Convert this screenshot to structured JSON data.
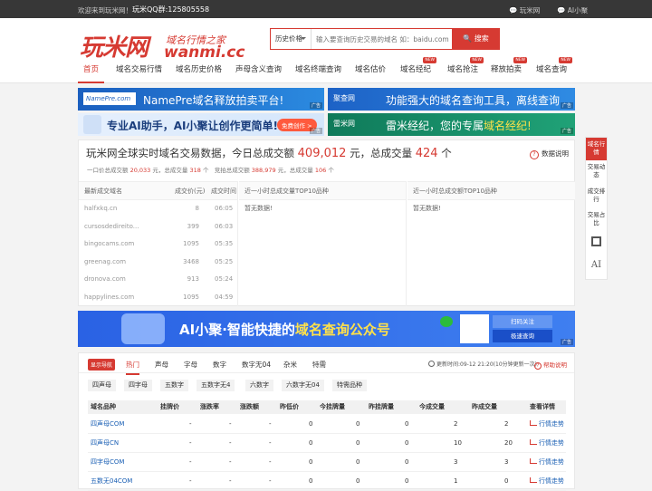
{
  "topbar": {
    "welcome": "欢迎来到玩米网！",
    "qq": "玩米QQ群:125805558",
    "link1": "玩米网",
    "link2": "AI小聚"
  },
  "logo": {
    "cn": "玩米网",
    "slogan": "域名行情之家",
    "domain": "wanmi.cc"
  },
  "search": {
    "category": "历史价格",
    "placeholder": "输入要查询历史交易的域名 如：baidu.com",
    "button": "搜索"
  },
  "nav": [
    {
      "label": "首页",
      "hot": ""
    },
    {
      "label": "域名交易行情",
      "hot": ""
    },
    {
      "label": "域名历史价格",
      "hot": ""
    },
    {
      "label": "声母含义查询",
      "hot": ""
    },
    {
      "label": "域名终端查询",
      "hot": ""
    },
    {
      "label": "域名估价",
      "hot": ""
    },
    {
      "label": "域名经纪",
      "hot": "NEW"
    },
    {
      "label": "域名抢注",
      "hot": "NEW"
    },
    {
      "label": "释放拍卖",
      "hot": "NEW"
    },
    {
      "label": "域名查询",
      "hot": "NEW"
    }
  ],
  "banners": {
    "b1_logo": "NamePre.com",
    "b1_text": "NamePre域名释放拍卖平台!",
    "ad": "广告",
    "b2_logo": "聚查网",
    "b2_text": "功能强大的域名查询工具，离线查询",
    "b3_text": "专业AI助手，AI小聚让创作更简单!",
    "b3_btn": "免费创作 >",
    "b4_logo": "雷米网",
    "b4_text_a": "雷米经纪，您的专属",
    "b4_text_b": "域名经纪!"
  },
  "stats": {
    "title_a": "玩米网全球实时域名交易数据，今日总成交额",
    "amount": "409,012",
    "title_b": "元，总成交量",
    "count": "424",
    "title_c": "个",
    "help": "数据说明",
    "sub1": "一口价总成交额",
    "sub1_v": "20,033",
    "sub1_u": "元，总成交量",
    "sub1_c": "318",
    "sub1_cu": "个",
    "sub2": "竞拍总成交额",
    "sub2_v": "388,979",
    "sub2_u": "元，总成交量",
    "sub2_c": "106",
    "sub2_cu": "个",
    "col1_h": [
      "最新成交域名",
      "成交价(元)",
      "成交时间"
    ],
    "recent": [
      {
        "d": "halfxkq.cn",
        "p": "8",
        "t": "06:05"
      },
      {
        "d": "cursosdedireito...",
        "p": "399",
        "t": "06:03"
      },
      {
        "d": "bingocams.com",
        "p": "1095",
        "t": "05:35"
      },
      {
        "d": "greenag.com",
        "p": "3468",
        "t": "05:25"
      },
      {
        "d": "dronova.com",
        "p": "913",
        "t": "05:24"
      },
      {
        "d": "happylines.com",
        "p": "1095",
        "t": "04:59"
      }
    ],
    "col2_h": "近一小时总成交量TOP10品种",
    "col3_h": "近一小时总成交额TOP10品种",
    "empty": "暂无数据!"
  },
  "bigbanner": {
    "text_a": "AI小聚·智能快捷的",
    "text_b": "域名查询公众号",
    "q1": "扫码关注",
    "q2": "极速查询",
    "ad": "广告"
  },
  "market": {
    "navbtn": "显示导航",
    "tabs": [
      "热门",
      "声母",
      "字母",
      "数字",
      "数字无04",
      "杂米",
      "特需"
    ],
    "updated": "更新时间:09-12 21:20(10分钟更新一次)",
    "help": "帮助说明",
    "chips": [
      "四声母",
      "四字母",
      "五数字",
      "五数字无4",
      "六数字",
      "六数字无04",
      "特需品种"
    ],
    "headers": [
      "域名品种",
      "挂牌价",
      "涨跌率",
      "涨跌额",
      "昨低价",
      "今挂牌量",
      "昨挂牌量",
      "今成交量",
      "昨成交量",
      "查看详情"
    ],
    "rows": [
      {
        "n": "四声母COM",
        "a": "-",
        "b": "-",
        "c": "-",
        "d": "0",
        "e": "0",
        "f": "0",
        "g": "2",
        "h": "2",
        "link": "行情走势"
      },
      {
        "n": "四声母CN",
        "a": "-",
        "b": "-",
        "c": "-",
        "d": "0",
        "e": "0",
        "f": "0",
        "g": "10",
        "h": "20",
        "link": "行情走势"
      },
      {
        "n": "四字母COM",
        "a": "-",
        "b": "-",
        "c": "-",
        "d": "0",
        "e": "0",
        "f": "0",
        "g": "3",
        "h": "3",
        "link": "行情走势"
      },
      {
        "n": "五数无04COM",
        "a": "-",
        "b": "-",
        "c": "-",
        "d": "0",
        "e": "0",
        "f": "0",
        "g": "1",
        "h": "0",
        "link": "行情走势"
      }
    ]
  },
  "side": [
    "域名行情",
    "交易动态",
    "成交排行",
    "交易占比"
  ],
  "side_ai": "AI"
}
